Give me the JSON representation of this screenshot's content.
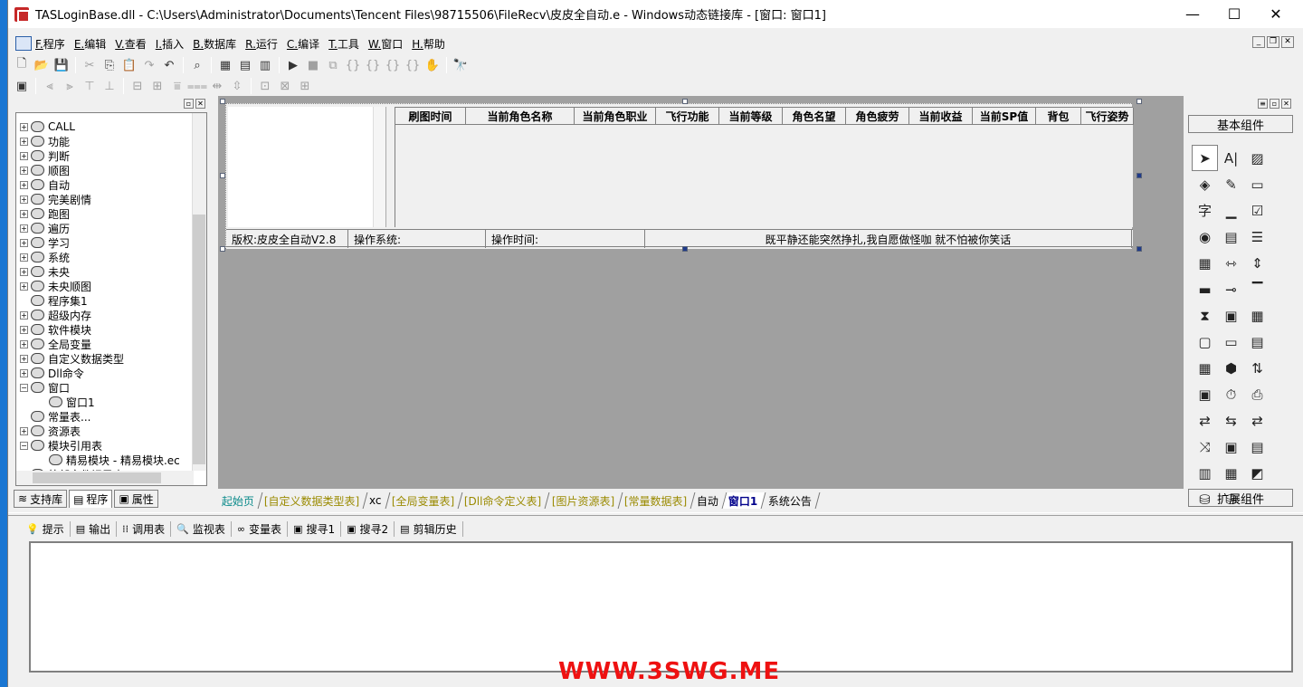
{
  "window": {
    "title": "TASLoginBase.dll - C:\\Users\\Administrator\\Documents\\Tencent Files\\98715506\\FileRecv\\皮皮全自动.e - Windows动态链接库 - [窗口: 窗口1]",
    "minimize": "—",
    "maximize": "☐",
    "close": "✕"
  },
  "menu": [
    {
      "key": "F.",
      "label": "程序"
    },
    {
      "key": "E.",
      "label": "编辑"
    },
    {
      "key": "V.",
      "label": "查看"
    },
    {
      "key": "I.",
      "label": "插入"
    },
    {
      "key": "B.",
      "label": "数据库"
    },
    {
      "key": "R.",
      "label": "运行"
    },
    {
      "key": "C.",
      "label": "编译"
    },
    {
      "key": "T.",
      "label": "工具"
    },
    {
      "key": "W.",
      "label": "窗口"
    },
    {
      "key": "H.",
      "label": "帮助"
    }
  ],
  "tree": [
    {
      "label": "CALL",
      "pm": "+"
    },
    {
      "label": "功能",
      "pm": "+"
    },
    {
      "label": "判断",
      "pm": "+"
    },
    {
      "label": "顺图",
      "pm": "+"
    },
    {
      "label": "自动",
      "pm": "+"
    },
    {
      "label": "完美剧情",
      "pm": "+"
    },
    {
      "label": "跑图",
      "pm": "+"
    },
    {
      "label": "遍历",
      "pm": "+"
    },
    {
      "label": "学习",
      "pm": "+"
    },
    {
      "label": "系统",
      "pm": "+"
    },
    {
      "label": "未央",
      "pm": "+"
    },
    {
      "label": "未央顺图",
      "pm": "+"
    },
    {
      "label": "程序集1",
      "pm": ""
    },
    {
      "label": "超级内存",
      "pm": "+"
    },
    {
      "label": "软件模块",
      "pm": "+"
    },
    {
      "label": "全局变量",
      "pm": "+"
    },
    {
      "label": "自定义数据类型",
      "pm": "+"
    },
    {
      "label": "Dll命令",
      "pm": "+"
    },
    {
      "label": "窗口",
      "pm": "−"
    },
    {
      "label": "窗口1",
      "pm": "",
      "child": true
    },
    {
      "label": "常量表...",
      "pm": ""
    },
    {
      "label": "资源表",
      "pm": "+"
    },
    {
      "label": "模块引用表",
      "pm": "−"
    },
    {
      "label": "精易模块 - 精易模块.ec",
      "pm": "",
      "child": true
    },
    {
      "label": "外部文件记录表",
      "pm": "+"
    }
  ],
  "left_tabs": [
    "支持库",
    "程序",
    "属性"
  ],
  "grid_headers": [
    "刷图时间",
    "当前角色名称",
    "当前角色职业",
    "飞行功能",
    "当前等级",
    "角色名望",
    "角色疲劳",
    "当前收益",
    "当前SP值",
    "背包",
    "飞行姿势"
  ],
  "status_cells": [
    "版权:皮皮全自动V2.8",
    "操作系统:",
    "操作时间:",
    "既平静还能突然挣扎,我自愿做怪咖 就不怕被你笑话"
  ],
  "doc_tabs": [
    "起始页",
    "[自定义数据类型表]",
    "xc",
    "[全局变量表]",
    "[Dll命令定义表]",
    "[图片资源表]",
    "[常量数据表]",
    "自动",
    "窗口1",
    "系统公告"
  ],
  "right_panel": {
    "header": "基本组件",
    "footer": "扩展组件"
  },
  "components": [
    "cursor-icon",
    "label-icon",
    "picture-icon",
    "shape-icon",
    "edit-icon",
    "frame-icon",
    "text-char-icon",
    "box-icon",
    "checkbox-icon",
    "radio-icon",
    "list-icon",
    "listbox-icon",
    "grid-icon",
    "scroll-h-icon",
    "scroll-v-icon",
    "progress-icon",
    "slider-icon",
    "tab-icon",
    "timer-icon",
    "image-box-icon",
    "calendar-icon",
    "panel-icon",
    "dir-icon",
    "file-icon",
    "tree-icon",
    "net-icon",
    "spin-icon",
    "window-icon",
    "clock-icon",
    "printer-icon",
    "link-a-icon",
    "link-b-icon",
    "db-a-icon",
    "db-b-icon",
    "db-c-icon",
    "db-d-icon",
    "db-e-icon",
    "db-f-icon",
    "chart-icon",
    "odbc-a-icon",
    "odbc-b-icon"
  ],
  "bottom_tabs": [
    {
      "icon": "💡",
      "label": "提示"
    },
    {
      "icon": "▤",
      "label": "输出"
    },
    {
      "icon": "⁞⁞",
      "label": "调用表"
    },
    {
      "icon": "🔍",
      "label": "监视表"
    },
    {
      "icon": "∞",
      "label": "变量表"
    },
    {
      "icon": "▣",
      "label": "搜寻1"
    },
    {
      "icon": "▣",
      "label": "搜寻2"
    },
    {
      "icon": "▤",
      "label": "剪辑历史"
    }
  ],
  "watermark": "WWW.3SWG.ME"
}
